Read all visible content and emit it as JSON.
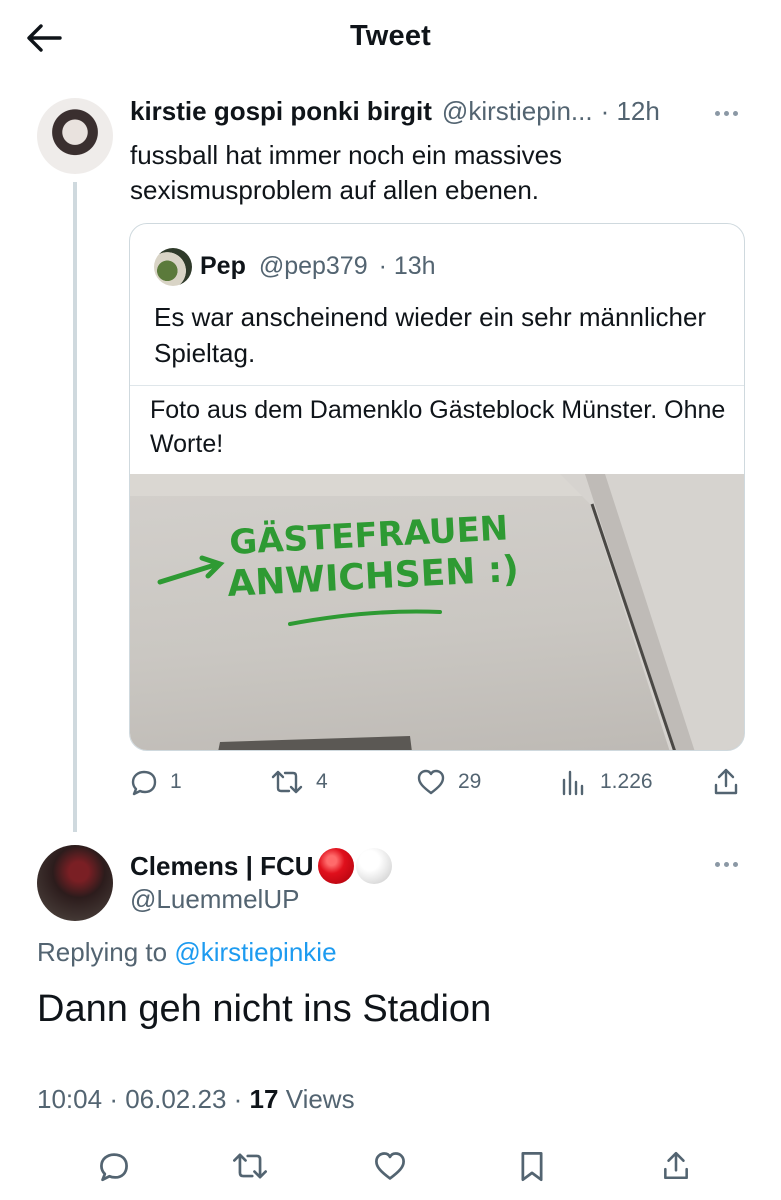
{
  "header": {
    "title": "Tweet",
    "back_icon": "arrow-left-icon"
  },
  "parent_tweet": {
    "author_name": "kirstie gospi ponki birgit",
    "handle": "@kirstiepin...",
    "time": "· 12h",
    "text": "fussball hat immer noch ein massives sexismusproblem auf allen ebenen."
  },
  "quote": {
    "author_name": "Pep",
    "handle": "@pep379",
    "time": "· 13h",
    "text": "Es war anscheinend wieder ein sehr männlicher Spieltag.",
    "caption": "Foto aus dem Damenklo Gästeblock Münster. Ohne Worte!",
    "graffiti_line1": "GÄSTEFRAUEN",
    "graffiti_line2": "ANWICHSEN :)",
    "graffiti_color": "#2e9a33"
  },
  "actions": {
    "replies": "1",
    "retweets": "4",
    "likes": "29",
    "views": "1.226"
  },
  "reply_tweet": {
    "author_name": "Clemens | FCU",
    "handle": "@LuemmelUP",
    "replying_prefix": "Replying to",
    "replying_handle": "@kirstiepinkie",
    "text": "Dann geh nicht ins Stadion",
    "time": "10:04",
    "date": "06.02.23",
    "views_count": "17",
    "views_label": "Views"
  },
  "colors": {
    "muted": "#536471",
    "link": "#1d9bf0",
    "border": "#cfd9de",
    "text": "#0f1419"
  }
}
